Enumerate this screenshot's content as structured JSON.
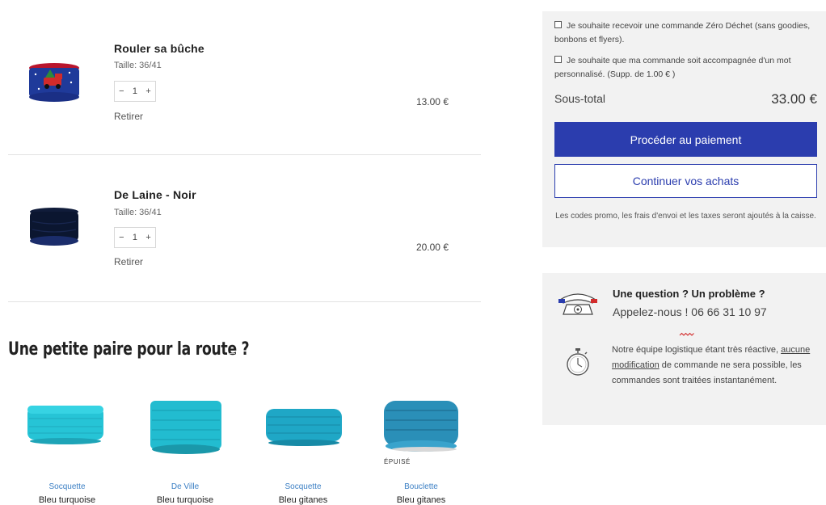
{
  "cart": {
    "items": [
      {
        "title": "Rouler sa bûche",
        "size": "Taille: 36/41",
        "qty": "1",
        "minus": "−",
        "plus": "+",
        "remove": "Retirer",
        "price": "13.00 €"
      },
      {
        "title": "De Laine - Noir",
        "size": "Taille: 36/41",
        "qty": "1",
        "minus": "−",
        "plus": "+",
        "remove": "Retirer",
        "price": "20.00 €"
      }
    ]
  },
  "upsell": {
    "title": "Une petite paire pour la route ?",
    "sold_out": "ÉPUISÉ",
    "products": [
      {
        "category": "Socquette",
        "name": "Bleu turquoise"
      },
      {
        "category": "De Ville",
        "name": "Bleu turquoise"
      },
      {
        "category": "Socquette",
        "name": "Bleu gitanes"
      },
      {
        "category": "Bouclette",
        "name": "Bleu gitanes"
      }
    ]
  },
  "summary": {
    "option_zero_waste": "Je souhaite recevoir une commande Zéro Déchet (sans goodies, bonbons et flyers).",
    "option_message": "Je souhaite que ma commande soit accompagnée d'un mot personnalisé. (Supp. de 1.00 € )",
    "subtotal_label": "Sous-total",
    "subtotal_value": "33.00 €",
    "checkout_label": "Procéder au paiement",
    "continue_label": "Continuer vos achats",
    "note": "Les codes promo, les frais d'envoi et les taxes seront ajoutés à la caisse."
  },
  "help": {
    "title": "Une question ? Un problème ?",
    "phone": "Appelez-nous ! 06 66 31 10 97",
    "text_before": "Notre équipe logistique étant très réactive,",
    "text_link": "aucune modification",
    "text_after": "de commande ne sera possible, les commandes sont traitées instantanément."
  },
  "colors": {
    "accent": "#2b3dae",
    "panel": "#f2f2f2",
    "link": "#3b7fc4"
  },
  "icons": [
    "telephone-icon",
    "stopwatch-icon",
    "squiggle-icon"
  ]
}
